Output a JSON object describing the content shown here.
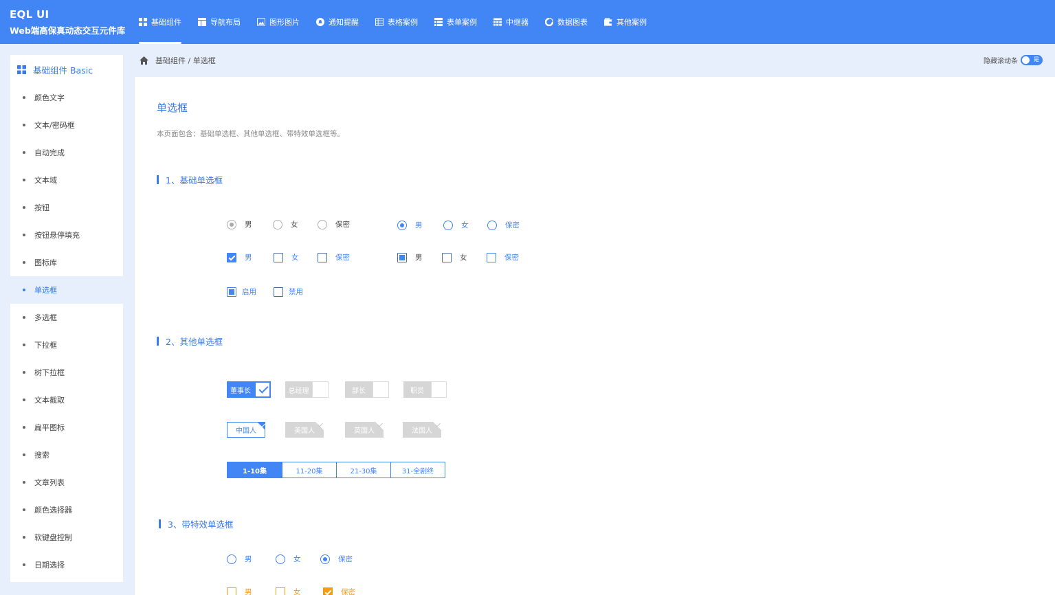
{
  "header": {
    "brand_title": "EQL UI",
    "brand_subtitle": "Web端高保真动态交互元件库",
    "nav": [
      {
        "label": "基础组件",
        "icon": "grid-icon"
      },
      {
        "label": "导航布局",
        "icon": "layout-icon"
      },
      {
        "label": "图形图片",
        "icon": "image-icon"
      },
      {
        "label": "通知提醒",
        "icon": "bell-icon"
      },
      {
        "label": "表格案例",
        "icon": "table-icon"
      },
      {
        "label": "表单案例",
        "icon": "form-icon"
      },
      {
        "label": "中继器",
        "icon": "repeater-icon"
      },
      {
        "label": "数据图表",
        "icon": "chart-icon"
      },
      {
        "label": "其他案例",
        "icon": "wallet-icon"
      }
    ]
  },
  "sidebar": {
    "title": "基础组件 Basic",
    "items": [
      "颜色文字",
      "文本/密码框",
      "自动完成",
      "文本域",
      "按钮",
      "按钮悬停填充",
      "图标库",
      "单选框",
      "多选框",
      "下拉框",
      "树下拉框",
      "文本截取",
      "扁平图标",
      "搜索",
      "文章列表",
      "颜色选择器",
      "软键盘控制",
      "日期选择"
    ],
    "active_index": 7
  },
  "breadcrumb": "基础组件 / 单选框",
  "scroll_toggle": {
    "label": "隐藏滚动条",
    "state": "是"
  },
  "page": {
    "title": "单选框",
    "desc": "本页面包含：基础单选框、其他单选框、带特效单选框等。",
    "sections": [
      "1、基础单选框",
      "2、其他单选框",
      "3、带特效单选框"
    ]
  },
  "basic": {
    "gender": [
      "男",
      "女",
      "保密"
    ],
    "enable": [
      "启用",
      "禁用"
    ]
  },
  "other": {
    "roles": [
      "董事长",
      "总经理",
      "部长",
      "职员"
    ],
    "nations": [
      "中国人",
      "美国人",
      "英国人",
      "法国人"
    ],
    "episodes": [
      "1-10集",
      "11-20集",
      "21-30集",
      "31-全剧终"
    ]
  },
  "effect": {
    "gender": [
      "男",
      "女",
      "保密"
    ]
  },
  "colors": {
    "primary": "#4285f4",
    "orange": "#f39c12"
  }
}
